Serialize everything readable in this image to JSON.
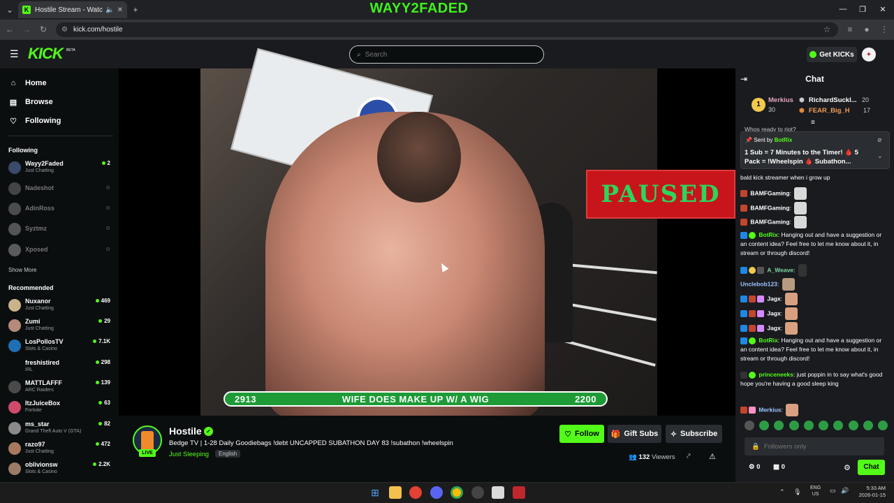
{
  "browser": {
    "tab_title": "Hostile Stream - Watch Live",
    "url": "kick.com/hostile",
    "overlay_text": "WAYY2FADED"
  },
  "header": {
    "logo": "KICK",
    "beta": "BETA",
    "search_placeholder": "Search",
    "get_kicks": "Get KICKs"
  },
  "sidebar": {
    "nav": [
      {
        "label": "Home",
        "icon": "home-icon"
      },
      {
        "label": "Browse",
        "icon": "browse-icon"
      },
      {
        "label": "Following",
        "icon": "heart-icon"
      }
    ],
    "following_header": "Following",
    "following": [
      {
        "name": "Wayy2Faded",
        "category": "Just Chatting",
        "viewers": "2",
        "live": true
      },
      {
        "name": "Nadeshot",
        "live": false
      },
      {
        "name": "AdinRoss",
        "live": false
      },
      {
        "name": "Syztmz",
        "live": false
      },
      {
        "name": "Xposed",
        "live": false
      }
    ],
    "show_more": "Show More",
    "recommended_header": "Recommended",
    "recommended": [
      {
        "name": "Nuxanor",
        "category": "Just Chatting",
        "viewers": "469"
      },
      {
        "name": "Zumi",
        "category": "Just Chatting",
        "viewers": "29"
      },
      {
        "name": "LosPollosTV",
        "category": "Slots & Casino",
        "viewers": "7.1K"
      },
      {
        "name": "freshistired",
        "category": "IRL",
        "viewers": "298"
      },
      {
        "name": "MATTLAFFF",
        "category": "ARC Raiders",
        "viewers": "139"
      },
      {
        "name": "ItzJuiceBox",
        "category": "Fortnite",
        "viewers": "63"
      },
      {
        "name": "ms_star",
        "category": "Grand Theft Auto V (GTA)",
        "viewers": "82"
      },
      {
        "name": "razo97",
        "category": "Just Chatting",
        "viewers": "472"
      },
      {
        "name": "oblivionsw",
        "category": "Slots & Casino",
        "viewers": "2.2K"
      }
    ]
  },
  "video": {
    "paused_label": "PAUSED",
    "ticker_left": "2913",
    "ticker_text": "WIFE DOES MAKE UP W/ A WIG",
    "ticker_right": "2200"
  },
  "stream": {
    "channel": "Hostile",
    "live_label": "LIVE",
    "title": "Bedge TV | 1-28 Daily Goodiebags !debt UNCAPPED SUBATHON DAY 83 !subathon !wheelspin",
    "category": "Just Sleeping",
    "language": "English",
    "follow": "Follow",
    "gift_subs": "Gift Subs",
    "subscribe": "Subscribe",
    "viewers": "132",
    "viewers_label": "Viewers"
  },
  "chat": {
    "title": "Chat",
    "leaderboard": [
      {
        "rank": "1",
        "name": "Merkius",
        "value": "30"
      },
      {
        "name": "RichardSuckl...",
        "value": "20"
      },
      {
        "name": "FEAR_Big_H",
        "value": "17"
      }
    ],
    "pinned": {
      "sent_by_label": "Sent by",
      "sender": "BotRix",
      "text": "1 Sub = 7 Minutes to the Timer! 🩸 5 Pack = !Wheelspin 🩸 Subathon..."
    },
    "partial_top": "Whos ready to riot?",
    "messages": [
      {
        "user": "",
        "text": "bald kick streamer when i grow up"
      },
      {
        "user": "BAMFGaming",
        "text": ""
      },
      {
        "user": "BAMFGaming",
        "text": ""
      },
      {
        "user": "BAMFGaming",
        "text": ""
      },
      {
        "user": "BotRix",
        "text": "Hanging out and have a suggestion or an content idea? Feel free to let me know about it, in stream or through discord!"
      },
      {
        "user": "A_Weave",
        "text": ""
      },
      {
        "user": "Unclebob123",
        "text": ""
      },
      {
        "user": "Jagx",
        "text": ""
      },
      {
        "user": "Jagx",
        "text": ""
      },
      {
        "user": "Jagx",
        "text": ""
      },
      {
        "user": "BotRix",
        "text": "Hanging out and have a suggestion or an content idea? Feel free to let me know about it, in stream or through discord!"
      },
      {
        "user": "princeneeks",
        "text": "just poppin in to say what's good hope you're having a good sleep king"
      },
      {
        "user": "Merkius",
        "text": ""
      }
    ],
    "input_placeholder": "Followers only",
    "count_a": "0",
    "count_b": "0",
    "send": "Chat"
  },
  "taskbar": {
    "lang": "ENG",
    "region": "US",
    "time": "5:33 AM",
    "date": "2026-01-15"
  }
}
